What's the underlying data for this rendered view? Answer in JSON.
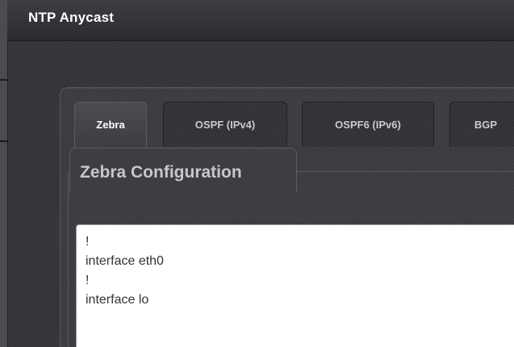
{
  "window": {
    "title": "NTP Anycast"
  },
  "tabs": [
    {
      "label": "Zebra",
      "active": true
    },
    {
      "label": "OSPF (IPv4)",
      "active": false
    },
    {
      "label": "OSPF6 (IPv6)",
      "active": false
    },
    {
      "label": "BGP",
      "active": false
    }
  ],
  "section": {
    "title": "Zebra Configuration"
  },
  "config": {
    "lines": [
      "!",
      "interface eth0",
      "!",
      "interface lo"
    ]
  }
}
